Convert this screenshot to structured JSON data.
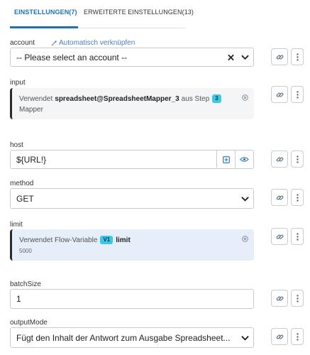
{
  "tabs": [
    {
      "label": "EINSTELLUNGEN(7)",
      "active": true
    },
    {
      "label": "ERWEITERTE EINSTELLUNGEN(13)",
      "active": false
    }
  ],
  "account": {
    "label": "account",
    "auto_link": "Automatisch verknüpfen",
    "value": "-- Please select an account --"
  },
  "input": {
    "label": "input",
    "prefix": "Verwendet",
    "ref": "spreadsheet@SpreadsheetMapper_3",
    "middle": "aus Step",
    "step_badge": "3",
    "step_name": "Mapper"
  },
  "host": {
    "label": "host",
    "value": "${URL!}"
  },
  "method": {
    "label": "method",
    "value": "GET"
  },
  "limit": {
    "label": "limit",
    "prefix": "Verwendet Flow-Variable",
    "badge": "V1",
    "var_name": "limit",
    "var_value": "5000"
  },
  "batchSize": {
    "label": "batchSize",
    "value": "1"
  },
  "outputMode": {
    "label": "outputMode",
    "value": "Fügt den Inhalt der Antwort zum Ausgabe Spreadsheet..."
  },
  "colors": {
    "accent": "#1a73b8",
    "badge": "#3bc7e6",
    "mapped_bg_input": "#f4f5f7",
    "mapped_bg_limit": "#e6eef9",
    "border": "#c8cdd3"
  },
  "icons": [
    "link-icon",
    "more-vertical-icon",
    "clear-icon",
    "chevron-down-icon",
    "remove-icon",
    "plus-square-icon",
    "eye-icon",
    "magic-wand-icon"
  ]
}
